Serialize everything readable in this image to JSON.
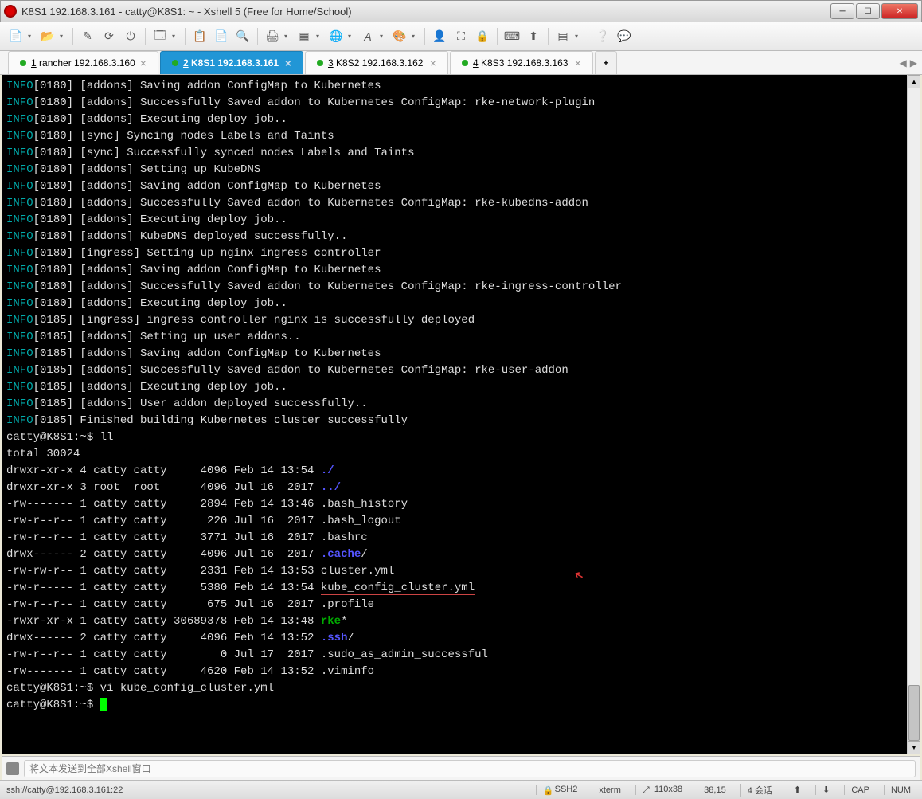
{
  "window": {
    "title": "K8S1 192.168.3.161 - catty@K8S1: ~ - Xshell 5 (Free for Home/School)"
  },
  "tabs": [
    {
      "num": "1",
      "label": "rancher 192.168.3.160",
      "active": false
    },
    {
      "num": "2",
      "label": "K8S1 192.168.3.161",
      "active": true
    },
    {
      "num": "3",
      "label": "K8S2 192.168.3.162",
      "active": false
    },
    {
      "num": "4",
      "label": "K8S3 192.168.3.163",
      "active": false
    }
  ],
  "terminal": {
    "log_lines": [
      {
        "ts": "0180",
        "txt": "[addons] Saving addon ConfigMap to Kubernetes"
      },
      {
        "ts": "0180",
        "txt": "[addons] Successfully Saved addon to Kubernetes ConfigMap: rke-network-plugin"
      },
      {
        "ts": "0180",
        "txt": "[addons] Executing deploy job.."
      },
      {
        "ts": "0180",
        "txt": "[sync] Syncing nodes Labels and Taints"
      },
      {
        "ts": "0180",
        "txt": "[sync] Successfully synced nodes Labels and Taints"
      },
      {
        "ts": "0180",
        "txt": "[addons] Setting up KubeDNS"
      },
      {
        "ts": "0180",
        "txt": "[addons] Saving addon ConfigMap to Kubernetes"
      },
      {
        "ts": "0180",
        "txt": "[addons] Successfully Saved addon to Kubernetes ConfigMap: rke-kubedns-addon"
      },
      {
        "ts": "0180",
        "txt": "[addons] Executing deploy job.."
      },
      {
        "ts": "0180",
        "txt": "[addons] KubeDNS deployed successfully.."
      },
      {
        "ts": "0180",
        "txt": "[ingress] Setting up nginx ingress controller"
      },
      {
        "ts": "0180",
        "txt": "[addons] Saving addon ConfigMap to Kubernetes"
      },
      {
        "ts": "0180",
        "txt": "[addons] Successfully Saved addon to Kubernetes ConfigMap: rke-ingress-controller"
      },
      {
        "ts": "0180",
        "txt": "[addons] Executing deploy job.."
      },
      {
        "ts": "0185",
        "txt": "[ingress] ingress controller nginx is successfully deployed"
      },
      {
        "ts": "0185",
        "txt": "[addons] Setting up user addons.."
      },
      {
        "ts": "0185",
        "txt": "[addons] Saving addon ConfigMap to Kubernetes"
      },
      {
        "ts": "0185",
        "txt": "[addons] Successfully Saved addon to Kubernetes ConfigMap: rke-user-addon"
      },
      {
        "ts": "0185",
        "txt": "[addons] Executing deploy job.."
      },
      {
        "ts": "0185",
        "txt": "[addons] User addon deployed successfully.."
      },
      {
        "ts": "0185",
        "txt": "Finished building Kubernetes cluster successfully"
      }
    ],
    "prompt1": "catty@K8S1:~$ ",
    "cmd1": "ll",
    "total": "total 30024",
    "listing": [
      {
        "perm": "drwxr-xr-x",
        "n": "4",
        "o": "catty",
        "g": "catty",
        "s": "4096",
        "d": "Feb 14 13:54",
        "name": "./",
        "cls": "dir"
      },
      {
        "perm": "drwxr-xr-x",
        "n": "3",
        "o": "root ",
        "g": "root ",
        "s": "4096",
        "d": "Jul 16  2017",
        "name": "../",
        "cls": "dir"
      },
      {
        "perm": "-rw-------",
        "n": "1",
        "o": "catty",
        "g": "catty",
        "s": "2894",
        "d": "Feb 14 13:46",
        "name": ".bash_history",
        "cls": ""
      },
      {
        "perm": "-rw-r--r--",
        "n": "1",
        "o": "catty",
        "g": "catty",
        "s": "220",
        "d": "Jul 16  2017",
        "name": ".bash_logout",
        "cls": ""
      },
      {
        "perm": "-rw-r--r--",
        "n": "1",
        "o": "catty",
        "g": "catty",
        "s": "3771",
        "d": "Jul 16  2017",
        "name": ".bashrc",
        "cls": ""
      },
      {
        "perm": "drwx------",
        "n": "2",
        "o": "catty",
        "g": "catty",
        "s": "4096",
        "d": "Jul 16  2017",
        "name": ".cache",
        "suffix": "/",
        "cls": "dir"
      },
      {
        "perm": "-rw-rw-r--",
        "n": "1",
        "o": "catty",
        "g": "catty",
        "s": "2331",
        "d": "Feb 14 13:53",
        "name": "cluster.yml",
        "cls": ""
      },
      {
        "perm": "-rw-r-----",
        "n": "1",
        "o": "catty",
        "g": "catty",
        "s": "5380",
        "d": "Feb 14 13:54",
        "name": "kube_config_cluster.yml",
        "cls": "",
        "hl": true
      },
      {
        "perm": "-rw-r--r--",
        "n": "1",
        "o": "catty",
        "g": "catty",
        "s": "675",
        "d": "Jul 16  2017",
        "name": ".profile",
        "cls": ""
      },
      {
        "perm": "-rwxr-xr-x",
        "n": "1",
        "o": "catty",
        "g": "catty",
        "s": "30689378",
        "d": "Feb 14 13:48",
        "name": "rke",
        "suffix": "*",
        "cls": "exe"
      },
      {
        "perm": "drwx------",
        "n": "2",
        "o": "catty",
        "g": "catty",
        "s": "4096",
        "d": "Feb 14 13:52",
        "name": ".ssh",
        "suffix": "/",
        "cls": "dir"
      },
      {
        "perm": "-rw-r--r--",
        "n": "1",
        "o": "catty",
        "g": "catty",
        "s": "0",
        "d": "Jul 17  2017",
        "name": ".sudo_as_admin_successful",
        "cls": ""
      },
      {
        "perm": "-rw-------",
        "n": "1",
        "o": "catty",
        "g": "catty",
        "s": "4620",
        "d": "Feb 14 13:52",
        "name": ".viminfo",
        "cls": ""
      }
    ],
    "prompt2": "catty@K8S1:~$ ",
    "cmd2": "vi kube_config_cluster.yml",
    "prompt3": "catty@K8S1:~$ "
  },
  "sendbar": {
    "placeholder": "将文本发送到全部Xshell窗口"
  },
  "status": {
    "left": "ssh://catty@192.168.3.161:22",
    "ssh": "SSH2",
    "term": "xterm",
    "size": "110x38",
    "pos": "38,15",
    "sessions": "4 会话",
    "cap": "CAP",
    "num": "NUM"
  },
  "glyphs": {
    "min": "─",
    "max": "☐",
    "close": "✕",
    "plus": "+",
    "left": "◀",
    "right": "▶",
    "up": "▲",
    "down": "▼",
    "lock": "🔒",
    "arrows": "⤢"
  }
}
